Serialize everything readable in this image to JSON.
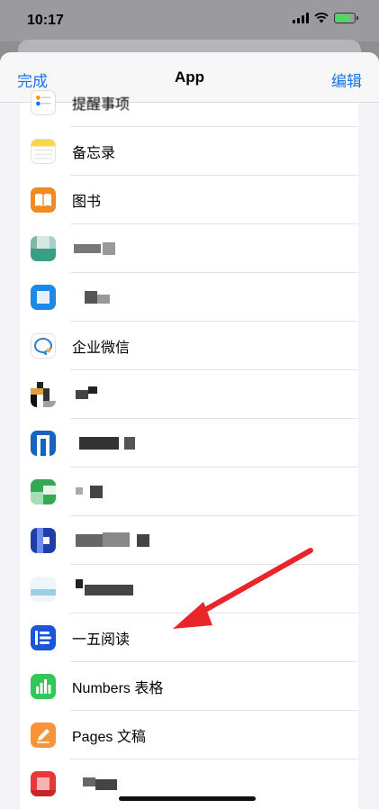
{
  "status": {
    "time": "10:17"
  },
  "nav": {
    "done": "完成",
    "title": "App",
    "edit": "编辑"
  },
  "apps": [
    {
      "label": "提醒事项",
      "icon": "reminders-icon"
    },
    {
      "label": "备忘录",
      "icon": "notes-icon"
    },
    {
      "label": "图书",
      "icon": "books-icon"
    },
    {
      "label": "",
      "icon": "pixelated-app-icon"
    },
    {
      "label": "",
      "icon": "pixelated-app-icon"
    },
    {
      "label": "企业微信",
      "icon": "wecom-icon"
    },
    {
      "label": "",
      "icon": "pixelated-app-icon"
    },
    {
      "label": "",
      "icon": "pixelated-app-icon"
    },
    {
      "label": "",
      "icon": "pixelated-app-icon"
    },
    {
      "label": "",
      "icon": "pixelated-app-icon"
    },
    {
      "label": "",
      "icon": "pixelated-app-icon"
    },
    {
      "label": "一五阅读",
      "icon": "yiwu-reader-icon"
    },
    {
      "label": "Numbers 表格",
      "icon": "numbers-icon"
    },
    {
      "label": "Pages 文稿",
      "icon": "pages-icon"
    },
    {
      "label": "",
      "icon": "pixelated-app-icon"
    }
  ],
  "colors": {
    "accent": "#1a73e8",
    "annotation_arrow": "#e8262a"
  }
}
